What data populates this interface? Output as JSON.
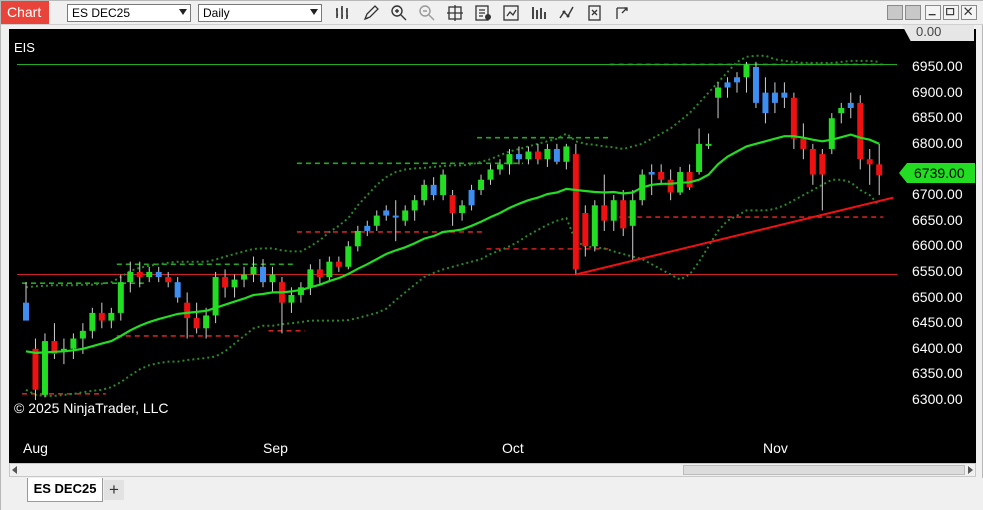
{
  "window": {
    "tab_label": "Chart",
    "instrument_select": "ES DEC25",
    "interval_select": "Daily"
  },
  "toolbar_icons": [
    "bars-icon",
    "pencil-icon",
    "zoom-in-icon",
    "zoom-out-icon",
    "crosshair-icon",
    "data-box-icon",
    "strategies-icon",
    "indicators-icon",
    "drawing-tools-icon",
    "properties-icon",
    "share-icon"
  ],
  "chart": {
    "instrument_label": "EIS",
    "copyright": "© 2025 NinjaTrader, LLC",
    "last_price": "6739.00",
    "top_tag": "0.00",
    "x_labels": [
      {
        "label": "Aug",
        "x": 22
      },
      {
        "label": "Sep",
        "x": 262
      },
      {
        "label": "Oct",
        "x": 501
      },
      {
        "label": "Nov",
        "x": 762
      }
    ]
  },
  "chart_data": {
    "type": "candlestick",
    "y_ticks": [
      6950,
      6900,
      6850,
      6800,
      6750,
      6700,
      6650,
      6600,
      6550,
      6500,
      6450,
      6400,
      6350,
      6300
    ],
    "y_tick_labels": [
      "6950.00",
      "6900.00",
      "6850.00",
      "6800.00",
      "6750.00",
      "6700.00",
      "6650.00",
      "6600.00",
      "6550.00",
      "6500.00",
      "6450.00",
      "6400.00",
      "6350.00",
      "6300.00"
    ],
    "ylim": [
      6280,
      6990
    ],
    "colors": {
      "up": "#22dd22",
      "down": "#ee1111",
      "neutral": "#3d8ef0",
      "ema": "#22dd22",
      "band": "#2a8a2a",
      "trend": "#ee1111",
      "hline_green": "#22aa22",
      "hline_red": "#cc2222"
    },
    "candles": [
      {
        "o": 6490,
        "h": 6530,
        "l": 6480,
        "c": 6455,
        "t": "n"
      },
      {
        "o": 6400,
        "h": 6420,
        "l": 6300,
        "c": 6320,
        "t": "d"
      },
      {
        "o": 6310,
        "h": 6430,
        "l": 6305,
        "c": 6415,
        "t": "u"
      },
      {
        "o": 6415,
        "h": 6450,
        "l": 6380,
        "c": 6390,
        "t": "d"
      },
      {
        "o": 6395,
        "h": 6420,
        "l": 6370,
        "c": 6400,
        "t": "u"
      },
      {
        "o": 6400,
        "h": 6430,
        "l": 6380,
        "c": 6420,
        "t": "u"
      },
      {
        "o": 6420,
        "h": 6450,
        "l": 6390,
        "c": 6435,
        "t": "u"
      },
      {
        "o": 6435,
        "h": 6480,
        "l": 6420,
        "c": 6470,
        "t": "u"
      },
      {
        "o": 6470,
        "h": 6490,
        "l": 6440,
        "c": 6455,
        "t": "d"
      },
      {
        "o": 6455,
        "h": 6480,
        "l": 6440,
        "c": 6470,
        "t": "u"
      },
      {
        "o": 6470,
        "h": 6545,
        "l": 6455,
        "c": 6530,
        "t": "u"
      },
      {
        "o": 6530,
        "h": 6570,
        "l": 6510,
        "c": 6550,
        "t": "u"
      },
      {
        "o": 6550,
        "h": 6570,
        "l": 6520,
        "c": 6540,
        "t": "d"
      },
      {
        "o": 6540,
        "h": 6560,
        "l": 6530,
        "c": 6550,
        "t": "u"
      },
      {
        "o": 6550,
        "h": 6560,
        "l": 6530,
        "c": 6540,
        "t": "n"
      },
      {
        "o": 6540,
        "h": 6550,
        "l": 6520,
        "c": 6530,
        "t": "d"
      },
      {
        "o": 6530,
        "h": 6540,
        "l": 6490,
        "c": 6500,
        "t": "n"
      },
      {
        "o": 6490,
        "h": 6510,
        "l": 6420,
        "c": 6460,
        "t": "d"
      },
      {
        "o": 6460,
        "h": 6490,
        "l": 6430,
        "c": 6440,
        "t": "d"
      },
      {
        "o": 6440,
        "h": 6480,
        "l": 6420,
        "c": 6465,
        "t": "u"
      },
      {
        "o": 6465,
        "h": 6550,
        "l": 6450,
        "c": 6540,
        "t": "u"
      },
      {
        "o": 6540,
        "h": 6555,
        "l": 6500,
        "c": 6520,
        "t": "d"
      },
      {
        "o": 6520,
        "h": 6545,
        "l": 6500,
        "c": 6535,
        "t": "u"
      },
      {
        "o": 6535,
        "h": 6560,
        "l": 6520,
        "c": 6545,
        "t": "u"
      },
      {
        "o": 6545,
        "h": 6580,
        "l": 6530,
        "c": 6560,
        "t": "u"
      },
      {
        "o": 6560,
        "h": 6575,
        "l": 6520,
        "c": 6530,
        "t": "n"
      },
      {
        "o": 6530,
        "h": 6560,
        "l": 6510,
        "c": 6545,
        "t": "u"
      },
      {
        "o": 6530,
        "h": 6540,
        "l": 6430,
        "c": 6490,
        "t": "d"
      },
      {
        "o": 6490,
        "h": 6520,
        "l": 6470,
        "c": 6505,
        "t": "u"
      },
      {
        "o": 6505,
        "h": 6530,
        "l": 6490,
        "c": 6520,
        "t": "u"
      },
      {
        "o": 6520,
        "h": 6565,
        "l": 6505,
        "c": 6555,
        "t": "u"
      },
      {
        "o": 6555,
        "h": 6575,
        "l": 6525,
        "c": 6540,
        "t": "d"
      },
      {
        "o": 6540,
        "h": 6580,
        "l": 6530,
        "c": 6570,
        "t": "u"
      },
      {
        "o": 6570,
        "h": 6580,
        "l": 6550,
        "c": 6560,
        "t": "d"
      },
      {
        "o": 6560,
        "h": 6610,
        "l": 6555,
        "c": 6600,
        "t": "u"
      },
      {
        "o": 6600,
        "h": 6640,
        "l": 6590,
        "c": 6630,
        "t": "u"
      },
      {
        "o": 6630,
        "h": 6650,
        "l": 6620,
        "c": 6640,
        "t": "n"
      },
      {
        "o": 6640,
        "h": 6670,
        "l": 6630,
        "c": 6660,
        "t": "u"
      },
      {
        "o": 6660,
        "h": 6680,
        "l": 6650,
        "c": 6670,
        "t": "n"
      },
      {
        "o": 6660,
        "h": 6690,
        "l": 6610,
        "c": 6660,
        "t": "n"
      },
      {
        "o": 6650,
        "h": 6680,
        "l": 6640,
        "c": 6670,
        "t": "u"
      },
      {
        "o": 6670,
        "h": 6700,
        "l": 6650,
        "c": 6690,
        "t": "u"
      },
      {
        "o": 6690,
        "h": 6730,
        "l": 6680,
        "c": 6720,
        "t": "u"
      },
      {
        "o": 6720,
        "h": 6735,
        "l": 6690,
        "c": 6700,
        "t": "n"
      },
      {
        "o": 6700,
        "h": 6750,
        "l": 6690,
        "c": 6740,
        "t": "u"
      },
      {
        "o": 6700,
        "h": 6710,
        "l": 6640,
        "c": 6665,
        "t": "d"
      },
      {
        "o": 6665,
        "h": 6690,
        "l": 6650,
        "c": 6680,
        "t": "u"
      },
      {
        "o": 6680,
        "h": 6720,
        "l": 6670,
        "c": 6710,
        "t": "n"
      },
      {
        "o": 6710,
        "h": 6740,
        "l": 6700,
        "c": 6730,
        "t": "u"
      },
      {
        "o": 6730,
        "h": 6760,
        "l": 6720,
        "c": 6750,
        "t": "u"
      },
      {
        "o": 6750,
        "h": 6770,
        "l": 6740,
        "c": 6760,
        "t": "u"
      },
      {
        "o": 6760,
        "h": 6790,
        "l": 6740,
        "c": 6780,
        "t": "u"
      },
      {
        "o": 6780,
        "h": 6795,
        "l": 6760,
        "c": 6770,
        "t": "n"
      },
      {
        "o": 6770,
        "h": 6795,
        "l": 6760,
        "c": 6785,
        "t": "u"
      },
      {
        "o": 6785,
        "h": 6800,
        "l": 6760,
        "c": 6770,
        "t": "d"
      },
      {
        "o": 6770,
        "h": 6800,
        "l": 6755,
        "c": 6790,
        "t": "u"
      },
      {
        "o": 6790,
        "h": 6800,
        "l": 6760,
        "c": 6765,
        "t": "n"
      },
      {
        "o": 6765,
        "h": 6800,
        "l": 6750,
        "c": 6795,
        "t": "u"
      },
      {
        "o": 6780,
        "h": 6800,
        "l": 6545,
        "c": 6555,
        "t": "d"
      },
      {
        "o": 6665,
        "h": 6680,
        "l": 6580,
        "c": 6600,
        "t": "d"
      },
      {
        "o": 6600,
        "h": 6690,
        "l": 6590,
        "c": 6680,
        "t": "u"
      },
      {
        "o": 6680,
        "h": 6740,
        "l": 6630,
        "c": 6650,
        "t": "d"
      },
      {
        "o": 6650,
        "h": 6700,
        "l": 6630,
        "c": 6690,
        "t": "u"
      },
      {
        "o": 6690,
        "h": 6710,
        "l": 6620,
        "c": 6635,
        "t": "d"
      },
      {
        "o": 6640,
        "h": 6710,
        "l": 6570,
        "c": 6690,
        "t": "u"
      },
      {
        "o": 6690,
        "h": 6750,
        "l": 6680,
        "c": 6740,
        "t": "u"
      },
      {
        "o": 6740,
        "h": 6760,
        "l": 6700,
        "c": 6745,
        "t": "n"
      },
      {
        "o": 6745,
        "h": 6760,
        "l": 6720,
        "c": 6730,
        "t": "d"
      },
      {
        "o": 6730,
        "h": 6750,
        "l": 6690,
        "c": 6705,
        "t": "d"
      },
      {
        "o": 6705,
        "h": 6755,
        "l": 6700,
        "c": 6745,
        "t": "u"
      },
      {
        "o": 6745,
        "h": 6760,
        "l": 6710,
        "c": 6715,
        "t": "d"
      },
      {
        "o": 6745,
        "h": 6830,
        "l": 6740,
        "c": 6800,
        "t": "u"
      },
      {
        "o": 6800,
        "h": 6820,
        "l": 6790,
        "c": 6800,
        "t": "u"
      },
      {
        "o": 6890,
        "h": 6920,
        "l": 6850,
        "c": 6910,
        "t": "u"
      },
      {
        "o": 6910,
        "h": 6930,
        "l": 6890,
        "c": 6920,
        "t": "n"
      },
      {
        "o": 6920,
        "h": 6940,
        "l": 6900,
        "c": 6930,
        "t": "n"
      },
      {
        "o": 6930,
        "h": 6960,
        "l": 6900,
        "c": 6955,
        "t": "u"
      },
      {
        "o": 6950,
        "h": 6960,
        "l": 6870,
        "c": 6880,
        "t": "n"
      },
      {
        "o": 6900,
        "h": 6930,
        "l": 6840,
        "c": 6860,
        "t": "n"
      },
      {
        "o": 6880,
        "h": 6920,
        "l": 6860,
        "c": 6900,
        "t": "n"
      },
      {
        "o": 6900,
        "h": 6920,
        "l": 6870,
        "c": 6890,
        "t": "n"
      },
      {
        "o": 6890,
        "h": 6900,
        "l": 6790,
        "c": 6810,
        "t": "d"
      },
      {
        "o": 6810,
        "h": 6840,
        "l": 6770,
        "c": 6790,
        "t": "d"
      },
      {
        "o": 6790,
        "h": 6800,
        "l": 6720,
        "c": 6740,
        "t": "d"
      },
      {
        "o": 6740,
        "h": 6790,
        "l": 6670,
        "c": 6780,
        "t": "d"
      },
      {
        "o": 6790,
        "h": 6860,
        "l": 6780,
        "c": 6850,
        "t": "u"
      },
      {
        "o": 6860,
        "h": 6880,
        "l": 6840,
        "c": 6870,
        "t": "u"
      },
      {
        "o": 6870,
        "h": 6900,
        "l": 6850,
        "c": 6880,
        "t": "n"
      },
      {
        "o": 6880,
        "h": 6895,
        "l": 6750,
        "c": 6770,
        "t": "d"
      },
      {
        "o": 6770,
        "h": 6790,
        "l": 6720,
        "c": 6760,
        "t": "d"
      },
      {
        "o": 6760,
        "h": 6800,
        "l": 6700,
        "c": 6739,
        "t": "d"
      }
    ],
    "ema": [
      6395,
      6392,
      6393,
      6394,
      6395,
      6397,
      6400,
      6405,
      6410,
      6415,
      6425,
      6436,
      6445,
      6452,
      6458,
      6463,
      6468,
      6470,
      6472,
      6474,
      6480,
      6486,
      6492,
      6498,
      6505,
      6507,
      6510,
      6510,
      6512,
      6515,
      6520,
      6525,
      6532,
      6538,
      6546,
      6556,
      6565,
      6575,
      6585,
      6592,
      6598,
      6606,
      6615,
      6620,
      6628,
      6630,
      6633,
      6640,
      6648,
      6657,
      6665,
      6675,
      6683,
      6690,
      6695,
      6702,
      6705,
      6712,
      6710,
      6708,
      6706,
      6705,
      6706,
      6703,
      6705,
      6715,
      6720,
      6722,
      6722,
      6724,
      6725,
      6730,
      6740,
      6760,
      6775,
      6785,
      6795,
      6800,
      6805,
      6810,
      6815,
      6815,
      6812,
      6808,
      6805,
      6808,
      6813,
      6818,
      6812,
      6808,
      6800
    ],
    "upper_band": [
      6520,
      6522,
      6523,
      6524,
      6524,
      6524,
      6525,
      6525,
      6527,
      6530,
      6540,
      6552,
      6558,
      6562,
      6565,
      6568,
      6570,
      6570,
      6570,
      6570,
      6574,
      6580,
      6585,
      6590,
      6595,
      6596,
      6596,
      6592,
      6590,
      6590,
      6600,
      6612,
      6628,
      6640,
      6655,
      6680,
      6700,
      6720,
      6735,
      6745,
      6750,
      6752,
      6753,
      6755,
      6757,
      6758,
      6758,
      6760,
      6765,
      6770,
      6778,
      6785,
      6790,
      6795,
      6800,
      6805,
      6810,
      6820,
      6805,
      6800,
      6798,
      6795,
      6793,
      6790,
      6795,
      6800,
      6810,
      6820,
      6830,
      6845,
      6860,
      6880,
      6900,
      6920,
      6940,
      6960,
      6970,
      6972,
      6972,
      6965,
      6962,
      6960,
      6958,
      6958,
      6958,
      6958,
      6960,
      6962,
      6962,
      6962,
      6960
    ],
    "lower_band": [
      6320,
      6310,
      6308,
      6308,
      6310,
      6312,
      6315,
      6318,
      6320,
      6325,
      6335,
      6348,
      6360,
      6368,
      6372,
      6375,
      6375,
      6378,
      6380,
      6382,
      6385,
      6395,
      6410,
      6425,
      6440,
      6445,
      6445,
      6448,
      6450,
      6452,
      6455,
      6455,
      6455,
      6455,
      6456,
      6460,
      6465,
      6470,
      6478,
      6495,
      6510,
      6525,
      6540,
      6548,
      6555,
      6560,
      6565,
      6570,
      6575,
      6585,
      6592,
      6600,
      6610,
      6622,
      6632,
      6642,
      6650,
      6655,
      6610,
      6600,
      6598,
      6596,
      6590,
      6585,
      6580,
      6575,
      6565,
      6555,
      6545,
      6535,
      6545,
      6570,
      6600,
      6630,
      6650,
      6660,
      6670,
      6670,
      6670,
      6673,
      6680,
      6690,
      6700,
      6710,
      6720,
      6730,
      6730,
      6725,
      6710,
      6700,
      6680
    ],
    "h_lines": [
      {
        "price": 6955,
        "from": 0,
        "to": 91,
        "style": "solid",
        "color": "#22aa22"
      },
      {
        "price": 6545,
        "from": 0,
        "to": 91,
        "style": "solid",
        "color": "#cc2222"
      }
    ],
    "dashed_levels": [
      {
        "price": 6528,
        "from": 0,
        "to": 12,
        "color": "#22aa22"
      },
      {
        "price": 6312,
        "from": 0,
        "to": 8,
        "color": "#cc2222"
      },
      {
        "price": 6565,
        "from": 10,
        "to": 28,
        "color": "#22aa22"
      },
      {
        "price": 6425,
        "from": 10,
        "to": 22,
        "color": "#cc2222"
      },
      {
        "price": 6435,
        "from": 26,
        "to": 29,
        "color": "#cc2222"
      },
      {
        "price": 6762,
        "from": 29,
        "to": 52,
        "color": "#22aa22"
      },
      {
        "price": 6628,
        "from": 29,
        "to": 48,
        "color": "#cc2222"
      },
      {
        "price": 6812,
        "from": 48,
        "to": 61,
        "color": "#22aa22"
      },
      {
        "price": 6595,
        "from": 49,
        "to": 61,
        "color": "#cc2222"
      },
      {
        "price": 6955,
        "from": 62,
        "to": 90,
        "color": "#22aa22"
      },
      {
        "price": 6657,
        "from": 63,
        "to": 90,
        "color": "#cc2222"
      }
    ],
    "trendline": {
      "from_index": 58,
      "from_price": 6545,
      "to_index": 91.5,
      "to_price": 6695,
      "color": "#ee1111"
    }
  }
}
